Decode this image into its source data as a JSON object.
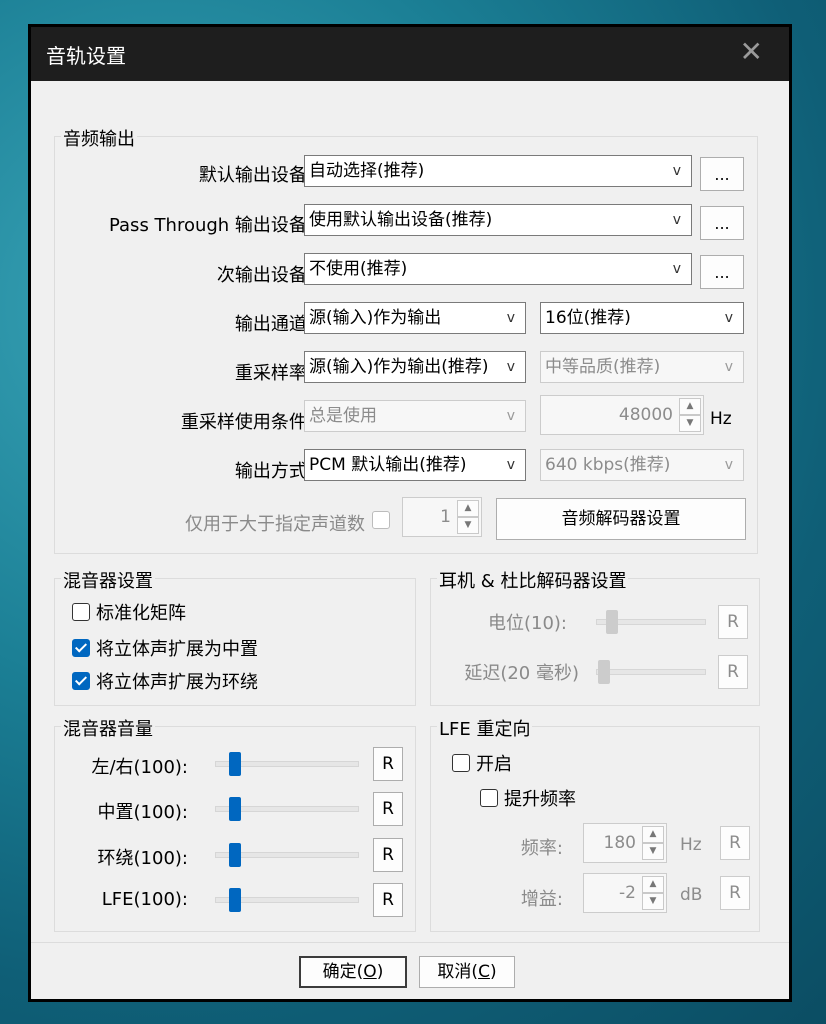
{
  "window": {
    "title": "音轨设置",
    "close_glyph": "✕"
  },
  "audio_output": {
    "group_title": "音频输出",
    "default_device": {
      "label": "默认输出设备:",
      "value": "自动选择(推荐)",
      "browse": "..."
    },
    "pass_through": {
      "label": "Pass Through 输出设备:",
      "value": "使用默认输出设备(推荐)",
      "browse": "..."
    },
    "secondary": {
      "label": "次输出设备:",
      "value": "不使用(推荐)",
      "browse": "..."
    },
    "channel": {
      "label": "输出通道:",
      "value": "源(输入)作为输出",
      "bits": "16位(推荐)"
    },
    "resample": {
      "label": "重采样率:",
      "value": "源(输入)作为输出(推荐)",
      "quality": "中等品质(推荐)"
    },
    "resample_condition": {
      "label": "重采样使用条件:",
      "value": "总是使用",
      "rate": "48000",
      "unit": "Hz"
    },
    "output_mode": {
      "label": "输出方式:",
      "value": "PCM 默认输出(推荐)",
      "bitrate": "640 kbps(推荐)"
    },
    "only_for_channels": {
      "label": "仅用于大于指定声道数",
      "value": "1"
    },
    "decoder_button": "音频解码器设置",
    "arrow_glyph": "v"
  },
  "mixer_settings": {
    "group_title": "混音器设置",
    "normalize": "标准化矩阵",
    "stereo_center": "将立体声扩展为中置",
    "stereo_surround": "将立体声扩展为环绕",
    "normalize_checked": false,
    "stereo_center_checked": true,
    "stereo_surround_checked": true
  },
  "headphone": {
    "group_title": "耳机 & 杜比解码器设置",
    "level_label": "电位(10):",
    "delay_label": "延迟(20 毫秒)",
    "reset": "R"
  },
  "mixer_volume": {
    "group_title": "混音器音量",
    "channels": [
      {
        "label": "左/右(100):",
        "reset": "R"
      },
      {
        "label": "中置(100):",
        "reset": "R"
      },
      {
        "label": "环绕(100):",
        "reset": "R"
      },
      {
        "label": "LFE(100):",
        "reset": "R"
      }
    ]
  },
  "lfe_redirect": {
    "group_title": "LFE 重定向",
    "enable": "开启",
    "raise_freq": "提升频率",
    "freq_label": "频率:",
    "freq_value": "180",
    "freq_unit": "Hz",
    "gain_label": "增益:",
    "gain_value": "-2",
    "gain_unit": "dB",
    "reset": "R"
  },
  "footer": {
    "ok_text": "确定(",
    "ok_key": "O",
    "ok_close": ")",
    "cancel_text": "取消(",
    "cancel_key": "C",
    "cancel_close": ")"
  },
  "colors": {
    "accent": "#0067c0",
    "titlebar": "#1e1e1e",
    "client": "#f0f0f0"
  }
}
